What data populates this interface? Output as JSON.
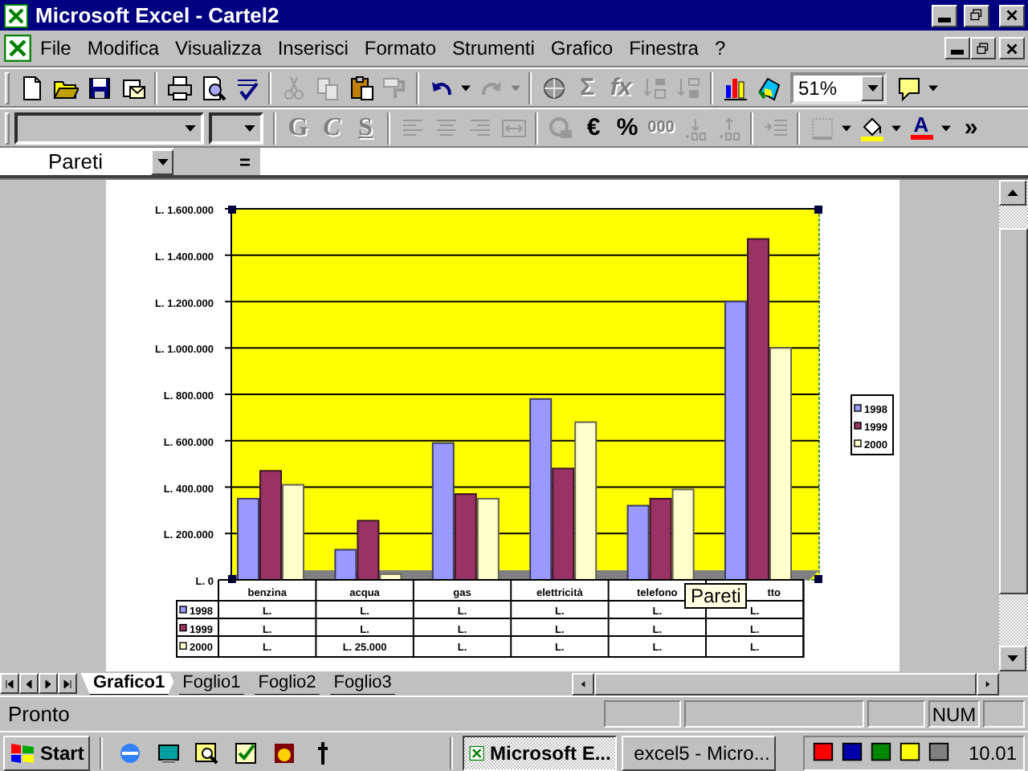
{
  "window": {
    "title": "Microsoft Excel - Cartel2"
  },
  "menu": [
    {
      "label": "File"
    },
    {
      "label": "Modifica"
    },
    {
      "label": "Visualizza"
    },
    {
      "label": "Inserisci"
    },
    {
      "label": "Formato"
    },
    {
      "label": "Strumenti"
    },
    {
      "label": "Grafico"
    },
    {
      "label": "Finestra"
    },
    {
      "label": "?"
    }
  ],
  "standard_toolbar": [
    {
      "kind": "new",
      "disabled": false
    },
    {
      "kind": "open",
      "disabled": false
    },
    {
      "kind": "save",
      "disabled": false
    },
    {
      "kind": "mail",
      "disabled": false
    },
    {
      "kind": "separator"
    },
    {
      "kind": "print",
      "disabled": false
    },
    {
      "kind": "preview",
      "disabled": false
    },
    {
      "kind": "spelling",
      "disabled": false
    },
    {
      "kind": "separator"
    },
    {
      "kind": "cut",
      "disabled": true
    },
    {
      "kind": "copy",
      "disabled": true
    },
    {
      "kind": "paste",
      "disabled": false
    },
    {
      "kind": "painter",
      "disabled": true
    },
    {
      "kind": "separator"
    },
    {
      "kind": "undo",
      "disabled": false
    },
    {
      "kind": "dropdown",
      "disabled": false
    },
    {
      "kind": "redo",
      "disabled": true
    },
    {
      "kind": "dropdown",
      "disabled": true
    },
    {
      "kind": "separator"
    },
    {
      "kind": "web",
      "disabled": true
    },
    {
      "kind": "text",
      "label": "Σ",
      "disabled": true
    },
    {
      "kind": "italic-text",
      "label": "fx",
      "disabled": true
    },
    {
      "kind": "sort-asc",
      "disabled": true
    },
    {
      "kind": "sort-desc",
      "disabled": true
    },
    {
      "kind": "separator"
    },
    {
      "kind": "chart",
      "disabled": false
    },
    {
      "kind": "map",
      "disabled": false
    },
    {
      "kind": "zoom-combo",
      "value": "51%",
      "disabled": false
    },
    {
      "kind": "help",
      "disabled": false
    },
    {
      "kind": "dropdown",
      "disabled": false
    }
  ],
  "format_toolbar": [
    {
      "kind": "font-combo",
      "disabled": false
    },
    {
      "kind": "size-combo",
      "disabled": false
    },
    {
      "kind": "separator"
    },
    {
      "kind": "bold",
      "label": "G",
      "disabled": true
    },
    {
      "kind": "italic",
      "label": "C",
      "disabled": true
    },
    {
      "kind": "underline",
      "label": "S",
      "disabled": true
    },
    {
      "kind": "separator"
    },
    {
      "kind": "align-left",
      "disabled": true
    },
    {
      "kind": "align-center",
      "disabled": true
    },
    {
      "kind": "align-right",
      "disabled": true
    },
    {
      "kind": "merge",
      "disabled": true
    },
    {
      "kind": "separator"
    },
    {
      "kind": "currency-convert",
      "disabled": true
    },
    {
      "kind": "text",
      "label": "€",
      "disabled": false
    },
    {
      "kind": "text",
      "label": "%",
      "disabled": false
    },
    {
      "kind": "text",
      "label": "000",
      "disabled": true
    },
    {
      "kind": "add-decimal",
      "disabled": true
    },
    {
      "kind": "remove-decimal",
      "disabled": true
    },
    {
      "kind": "separator"
    },
    {
      "kind": "indent",
      "disabled": true
    },
    {
      "kind": "separator"
    },
    {
      "kind": "borders",
      "disabled": true
    },
    {
      "kind": "dropdown",
      "disabled": false
    },
    {
      "kind": "fill-color",
      "disabled": false
    },
    {
      "kind": "dropdown",
      "disabled": false
    },
    {
      "kind": "font-color",
      "label": "A",
      "disabled": false
    },
    {
      "kind": "dropdown",
      "disabled": false
    },
    {
      "kind": "text",
      "label": "»",
      "disabled": false
    }
  ],
  "formula_bar": {
    "name_box": "Pareti",
    "equals": "="
  },
  "chart": {
    "chart_data": {
      "type": "bar",
      "categories": [
        "benzina",
        "acqua",
        "gas",
        "elettricità",
        "telefono",
        "tto"
      ],
      "series": [
        {
          "name": "1998",
          "color": "#9999ff",
          "values": [
            350000,
            130000,
            590000,
            780000,
            320000,
            1200000
          ]
        },
        {
          "name": "1999",
          "color": "#993366",
          "values": [
            470000,
            255000,
            370000,
            480000,
            350000,
            1470000
          ]
        },
        {
          "name": "2000",
          "color": "#ffffcc",
          "values": [
            410000,
            25000,
            350000,
            680000,
            390000,
            1000000
          ]
        }
      ],
      "ylim": [
        0,
        1600000
      ],
      "legend": "right",
      "grid": true,
      "yticks": [
        {
          "value": 0,
          "label": "L. 0"
        },
        {
          "value": 200000,
          "label": "L. 200.000"
        },
        {
          "value": 400000,
          "label": "L. 400.000"
        },
        {
          "value": 600000,
          "label": "L. 600.000"
        },
        {
          "value": 800000,
          "label": "L. 800.000"
        },
        {
          "value": 1000000,
          "label": "L. 1.000.000"
        },
        {
          "value": 1200000,
          "label": "L. 1.200.000"
        },
        {
          "value": 1400000,
          "label": "L. 1.400.000"
        },
        {
          "value": 1600000,
          "label": "L. 1.600.000"
        }
      ]
    },
    "data_table": [
      {
        "label": "1998",
        "cells": [
          "L.",
          "L.",
          "L.",
          "L.",
          "L.",
          "L."
        ]
      },
      {
        "label": "1999",
        "cells": [
          "L.",
          "L.",
          "L.",
          "L.",
          "L.",
          "L."
        ]
      },
      {
        "label": "2000",
        "cells": [
          "L.",
          "L. 25.000",
          "L.",
          "L.",
          "L.",
          "L."
        ]
      }
    ],
    "tooltip": "Pareti"
  },
  "sheet_tabs": [
    {
      "label": "Grafico1",
      "selected": true
    },
    {
      "label": "Foglio1",
      "selected": false
    },
    {
      "label": "Foglio2",
      "selected": false
    },
    {
      "label": "Foglio3",
      "selected": false
    }
  ],
  "status_bar": {
    "text": "Pronto",
    "indicator": "NUM"
  },
  "taskbar": {
    "start": "Start",
    "tasks": [
      {
        "label": "Microsoft E...",
        "selected": true
      },
      {
        "label": "excel5 - Micro...",
        "selected": false
      }
    ],
    "clock": "10.01"
  }
}
